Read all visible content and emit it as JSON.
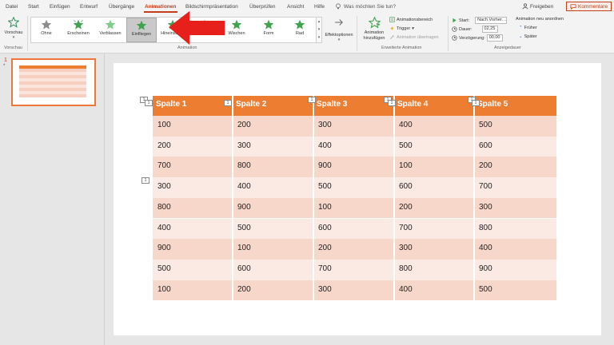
{
  "menu": {
    "tabs": [
      "Datei",
      "Start",
      "Einfügen",
      "Entwurf",
      "Übergänge",
      "Animationen",
      "Bildschirmpräsentation",
      "Überprüfen",
      "Ansicht",
      "Hilfe"
    ],
    "search_text": "Was möchten Sie tun?",
    "share_label": "Freigeben",
    "comments_label": "Kommentare"
  },
  "ribbon": {
    "preview": {
      "label": "Vorschau",
      "group_label": "Vorschau"
    },
    "animation_group_label": "Animation",
    "gallery": [
      {
        "label": "Ohne",
        "icon": "star-gray-icon"
      },
      {
        "label": "Erscheinen",
        "icon": "star-green-icon"
      },
      {
        "label": "Verblassen",
        "icon": "star-green-icon"
      },
      {
        "label": "Einfliegen",
        "icon": "star-green-icon"
      },
      {
        "label": "Hineinsch…",
        "icon": "star-green-icon"
      },
      {
        "label": "…en",
        "icon": "star-green-icon"
      },
      {
        "label": "Wischen",
        "icon": "star-green-icon"
      },
      {
        "label": "Form",
        "icon": "star-green-icon"
      },
      {
        "label": "Rad",
        "icon": "star-green-icon"
      }
    ],
    "selected_index": 3,
    "effect_options": "Effektoptionen",
    "add_animation": "Animation hinzufügen",
    "animation_pane": "Animationsbereich",
    "trigger": "Trigger",
    "animation_painter": "Animation übertragen",
    "advanced_group_label": "Erweiterte Animation",
    "start_label": "Start:",
    "start_value": "Nach Vorher…",
    "duration_label": "Dauer:",
    "duration_value": "02,25",
    "delay_label": "Verzögerung:",
    "delay_value": "00,00",
    "timing_group_label": "Anzeigedauer",
    "reorder_label": "Animation neu anordnen",
    "earlier": "Früher",
    "later": "Später"
  },
  "slides_pane": {
    "slide_number": "1",
    "star": "*"
  },
  "table": {
    "headers": [
      "Spalte 1",
      "Spalte 2",
      "Spalte 3",
      "Spalte 4",
      "Spalte 5"
    ],
    "rows": [
      [
        "100",
        "200",
        "300",
        "400",
        "500"
      ],
      [
        "200",
        "300",
        "400",
        "500",
        "600"
      ],
      [
        "700",
        "800",
        "900",
        "100",
        "200"
      ],
      [
        "300",
        "400",
        "500",
        "600",
        "700"
      ],
      [
        "800",
        "900",
        "100",
        "200",
        "300"
      ],
      [
        "400",
        "500",
        "600",
        "700",
        "800"
      ],
      [
        "900",
        "100",
        "200",
        "300",
        "400"
      ],
      [
        "500",
        "600",
        "700",
        "800",
        "900"
      ],
      [
        "100",
        "200",
        "300",
        "400",
        "500"
      ]
    ],
    "header_color": "#ED7D31",
    "row_color_dark": "#F8D7CB",
    "row_color_light": "#FBEAE4"
  },
  "animation_tags": [
    "1",
    "1",
    "1",
    "1",
    "1",
    "1",
    "1",
    "1"
  ],
  "colors": {
    "accent": "#C43E1C",
    "arrow": "#E8201C"
  }
}
